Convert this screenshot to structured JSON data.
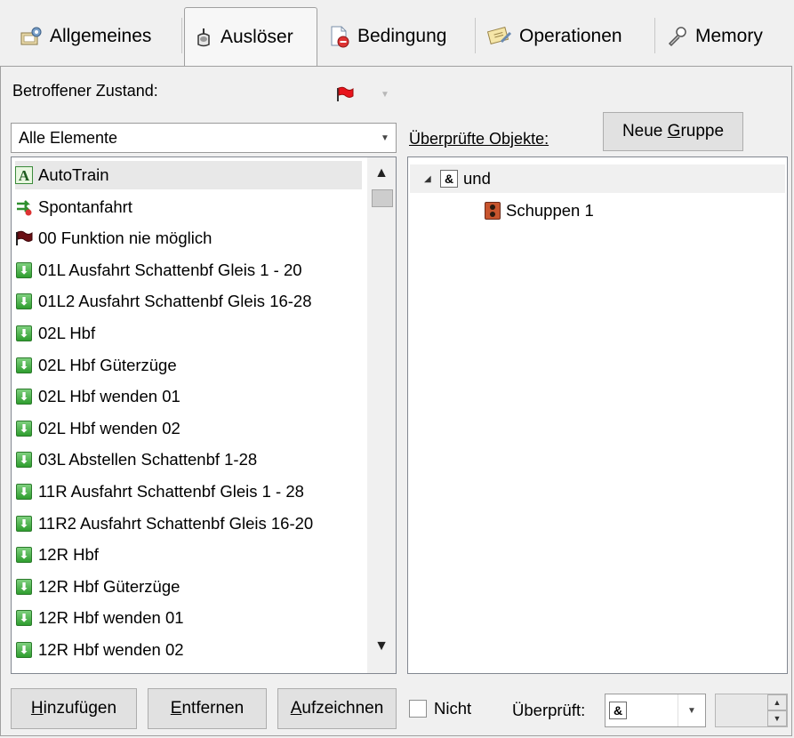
{
  "tabs": [
    {
      "label": "Allgemeines",
      "icon": "settings-icon"
    },
    {
      "label": "Auslöser",
      "icon": "trigger-icon",
      "active": true
    },
    {
      "label": "Bedingung",
      "icon": "condition-icon"
    },
    {
      "label": "Operationen",
      "icon": "operations-icon"
    },
    {
      "label": "Memory",
      "icon": "memory-icon"
    }
  ],
  "state": {
    "label": "Betroffener Zustand:",
    "flag_color": "#e8141c"
  },
  "filter": {
    "value": "Alle Elemente"
  },
  "checked_objects": {
    "label": "Überprüfte Objekte:",
    "new_group_button": {
      "pre": "Neue ",
      "accel": "G",
      "post": "ruppe"
    }
  },
  "elements_list": [
    {
      "label": "AutoTrain",
      "icon": "autotrain-icon",
      "selected": true
    },
    {
      "label": "Spontanfahrt",
      "icon": "spontaneous-icon"
    },
    {
      "label": "00 Funktion nie möglich",
      "icon": "flag-icon"
    },
    {
      "label": "01L Ausfahrt Schattenbf Gleis 1 - 20",
      "icon": "route-icon"
    },
    {
      "label": "01L2 Ausfahrt Schattenbf Gleis 16-28",
      "icon": "route-icon"
    },
    {
      "label": "02L Hbf",
      "icon": "route-icon"
    },
    {
      "label": "02L Hbf Güterzüge",
      "icon": "route-icon"
    },
    {
      "label": "02L Hbf wenden 01",
      "icon": "route-icon"
    },
    {
      "label": "02L Hbf wenden 02",
      "icon": "route-icon"
    },
    {
      "label": "03L Abstellen Schattenbf 1-28",
      "icon": "route-icon"
    },
    {
      "label": "11R Ausfahrt Schattenbf Gleis 1 - 28",
      "icon": "route-icon"
    },
    {
      "label": "11R2 Ausfahrt Schattenbf Gleis 16-20",
      "icon": "route-icon"
    },
    {
      "label": "12R Hbf",
      "icon": "route-icon"
    },
    {
      "label": "12R Hbf Güterzüge",
      "icon": "route-icon"
    },
    {
      "label": "12R Hbf wenden 01",
      "icon": "route-icon"
    },
    {
      "label": "12R Hbf wenden 02",
      "icon": "route-icon"
    }
  ],
  "tree": {
    "root": {
      "label": "und",
      "symbol": "&"
    },
    "children": [
      {
        "label": "Schuppen 1",
        "icon": "signal-icon"
      }
    ]
  },
  "bottom": {
    "add_button": {
      "accel": "H",
      "rest": "inzufügen"
    },
    "remove_button": {
      "accel": "E",
      "rest": "ntfernen"
    },
    "record_button": {
      "accel": "A",
      "rest": "ufzeichnen"
    },
    "not_label": "Nicht",
    "checked_label": "Überprüft:",
    "operator_value": "&"
  }
}
